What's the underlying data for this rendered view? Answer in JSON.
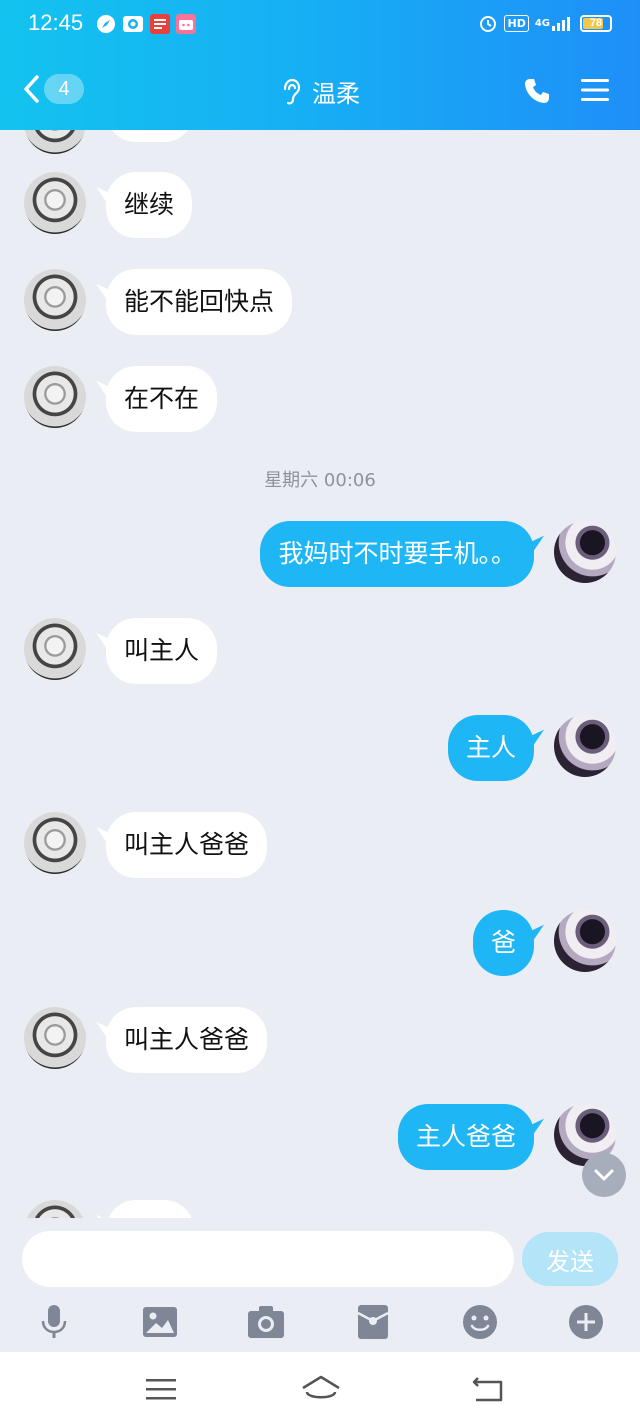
{
  "status_bar": {
    "time": "12:45",
    "network": "4G",
    "hd_label": "HD",
    "battery": "78",
    "battery_level": 0.78,
    "apps": [
      {
        "icon": "compass-app-icon",
        "color": "#ffffff"
      },
      {
        "icon": "camera-app-icon",
        "color": "#ffffff"
      },
      {
        "icon": "toutiao-app-icon",
        "color": "#e8413b"
      },
      {
        "icon": "bilibili-app-icon",
        "color": "#fb7299"
      }
    ]
  },
  "header": {
    "back_count": "4",
    "title": "温柔",
    "title_icon": "ear-icon",
    "right_icons": [
      "phone-icon",
      "menu-icon"
    ]
  },
  "chat": {
    "timestamp": "星期六  00:06",
    "messages": [
      {
        "side": "left",
        "text": "继续"
      },
      {
        "side": "left",
        "text": "能不能回快点"
      },
      {
        "side": "left",
        "text": "在不在"
      },
      {
        "side": "right",
        "text": "我妈时不时要手机。。"
      },
      {
        "side": "left",
        "text": "叫主人"
      },
      {
        "side": "right",
        "text": "主人"
      },
      {
        "side": "left",
        "text": "叫主人爸爸"
      },
      {
        "side": "right",
        "text": "爸"
      },
      {
        "side": "left",
        "text": "叫主人爸爸"
      },
      {
        "side": "right",
        "text": "主人爸爸"
      }
    ]
  },
  "composer": {
    "input_value": "",
    "send_label": "发送",
    "tools": [
      "microphone-icon",
      "image-icon",
      "camera-icon",
      "red-packet-icon",
      "emoji-icon",
      "plus-icon"
    ]
  },
  "colors": {
    "accent": "#1fb6f5",
    "header_start": "#13c3ef",
    "header_end": "#1e8ff8",
    "chat_bg": "#eaedf4",
    "send_disabled": "#b3e4f7"
  },
  "navigation": [
    "menu-nav-icon",
    "home-nav-icon",
    "back-nav-icon"
  ]
}
